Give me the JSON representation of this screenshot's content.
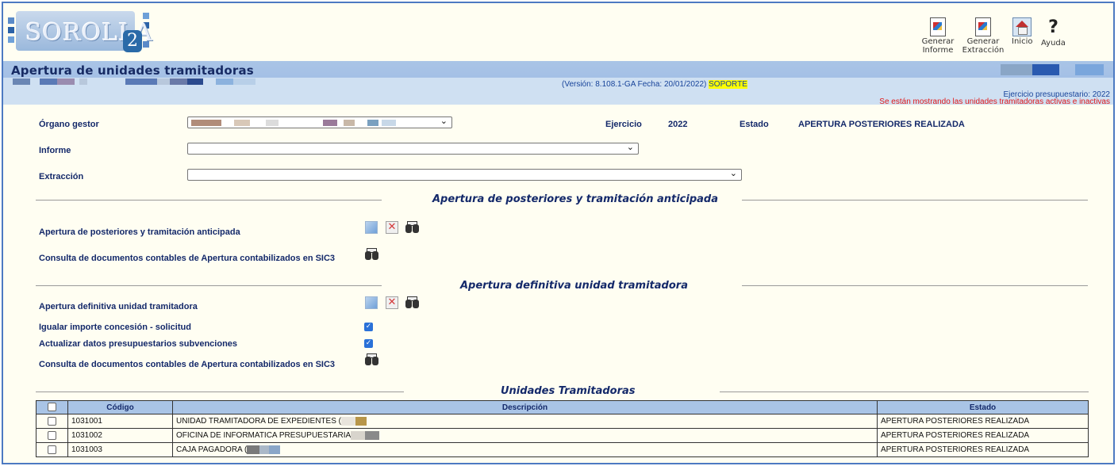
{
  "app": {
    "name": "SOROLLA",
    "name_suffix": "2"
  },
  "toolbar": {
    "generar_informe": "Generar Informe",
    "generar_extraccion": "Generar Extracción",
    "inicio": "Inicio",
    "ayuda": "Ayuda"
  },
  "header": {
    "title": "Apertura de unidades tramitadoras",
    "version_prefix": "(Versión: 8.108.1-GA Fecha: 20/01/2022) ",
    "version_highlight": "SOPORTE",
    "ejercicio_presupuestario": "Ejercicio presupuestario: 2022",
    "aviso": "Se están mostrando las unidades tramitadoras activas e inactivas"
  },
  "form": {
    "organo_gestor_label": "Órgano gestor",
    "ejercicio_label": "Ejercicio",
    "ejercicio_value": "2022",
    "estado_label": "Estado",
    "estado_value": "APERTURA POSTERIORES REALIZADA",
    "informe_label": "Informe",
    "extraccion_label": "Extracción"
  },
  "section1": {
    "title": "Apertura de posteriores y tramitación anticipada",
    "row1_label": "Apertura de posteriores y tramitación anticipada",
    "row2_label": "Consulta de documentos contables de Apertura contabilizados en SIC3"
  },
  "section2": {
    "title": "Apertura definitiva unidad tramitadora",
    "row1_label": "Apertura definitiva unidad tramitadora",
    "row2_label": "Igualar importe concesión - solicitud",
    "row3_label": "Actualizar datos presupuestarios subvenciones",
    "row4_label": "Consulta de documentos contables de Apertura contabilizados en SIC3",
    "igualar_checked": true,
    "actualizar_checked": true
  },
  "units": {
    "title": "Unidades Tramitadoras",
    "columns": [
      "Código",
      "Descripción",
      "Estado"
    ],
    "rows": [
      {
        "codigo": "1031001",
        "descripcion": "UNIDAD TRAMITADORA DE EXPEDIENTES (",
        "estado": "APERTURA POSTERIORES REALIZADA"
      },
      {
        "codigo": "1031002",
        "descripcion": "OFICINA DE INFORMATICA PRESUPUESTARIA",
        "estado": "APERTURA POSTERIORES REALIZADA"
      },
      {
        "codigo": "1031003",
        "descripcion": "CAJA PAGADORA (",
        "estado": "APERTURA POSTERIORES REALIZADA"
      }
    ]
  },
  "colors": {
    "accent": "#a9c4e6",
    "title_text": "#172b64",
    "warning": "#e21b1b",
    "background": "#fffef2"
  },
  "icons": [
    "generar-informe-icon",
    "generar-extraccion-icon",
    "home-icon",
    "help-icon",
    "accept-icon",
    "cancel-icon",
    "binoculars-icon"
  ]
}
